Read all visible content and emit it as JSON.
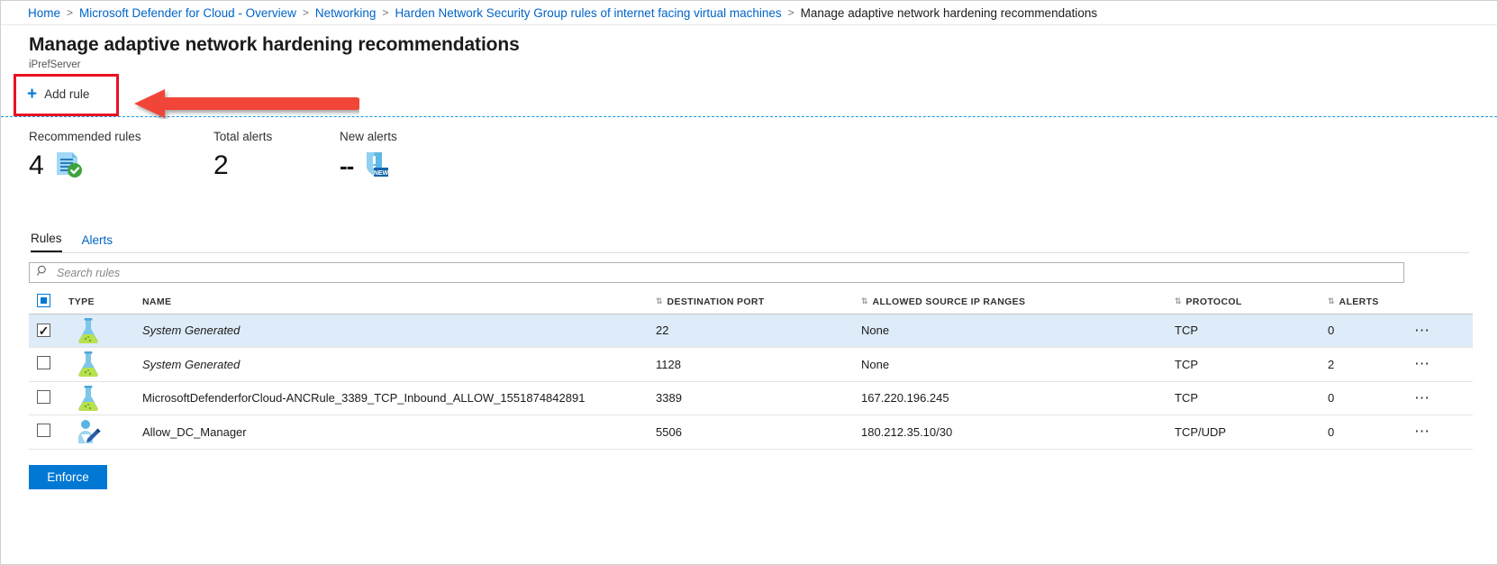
{
  "breadcrumb": {
    "items": [
      {
        "label": "Home",
        "link": true
      },
      {
        "label": "Microsoft Defender for Cloud - Overview",
        "link": true
      },
      {
        "label": "Networking",
        "link": true
      },
      {
        "label": "Harden Network Security Group rules of internet facing virtual machines",
        "link": true
      },
      {
        "label": "Manage adaptive network hardening recommendations",
        "link": false
      }
    ],
    "separator": ">"
  },
  "header": {
    "title": "Manage adaptive network hardening recommendations",
    "subtitle": "iPrefServer"
  },
  "commandbar": {
    "add_rule_label": "Add rule",
    "add_rule_icon": "plus-icon",
    "highlight_color": "#e81123",
    "annotation_arrow_color": "#f04438"
  },
  "stats": [
    {
      "label": "Recommended rules",
      "value": "4",
      "icon": "rules-document-check-icon"
    },
    {
      "label": "Total alerts",
      "value": "2",
      "icon": ""
    },
    {
      "label": "New alerts",
      "value": "--",
      "icon": "shield-new-alert-icon"
    }
  ],
  "tabs": [
    {
      "label": "Rules",
      "active": true
    },
    {
      "label": "Alerts",
      "active": false
    }
  ],
  "search": {
    "placeholder": "Search rules",
    "value": "",
    "icon": "search-icon"
  },
  "table": {
    "columns": [
      {
        "key": "check",
        "label": "",
        "sortable": false
      },
      {
        "key": "type",
        "label": "TYPE",
        "sortable": false
      },
      {
        "key": "name",
        "label": "NAME",
        "sortable": true
      },
      {
        "key": "port",
        "label": "DESTINATION PORT",
        "sortable": true
      },
      {
        "key": "ip",
        "label": "ALLOWED SOURCE IP RANGES",
        "sortable": true
      },
      {
        "key": "protocol",
        "label": "PROTOCOL",
        "sortable": true
      },
      {
        "key": "alerts",
        "label": "ALERTS",
        "sortable": false
      },
      {
        "key": "menu",
        "label": "",
        "sortable": false
      }
    ],
    "sort_icon": "sort-updown-icon",
    "menu_icon": "more-options-icon",
    "rows": [
      {
        "checked": true,
        "selected": true,
        "type_icon": "flask-system-generated-icon",
        "name": "System Generated",
        "name_italic": true,
        "port": "22",
        "ip": "None",
        "protocol": "TCP",
        "alerts": "0"
      },
      {
        "checked": false,
        "selected": false,
        "type_icon": "flask-system-generated-icon",
        "name": "System Generated",
        "name_italic": true,
        "port": "1128",
        "ip": "None",
        "protocol": "TCP",
        "alerts": "2"
      },
      {
        "checked": false,
        "selected": false,
        "type_icon": "flask-system-generated-icon",
        "name": "MicrosoftDefenderforCloud-ANCRule_3389_TCP_Inbound_ALLOW_1551874842891",
        "name_italic": false,
        "port": "3389",
        "ip": "167.220.196.245",
        "protocol": "TCP",
        "alerts": "0"
      },
      {
        "checked": false,
        "selected": false,
        "type_icon": "user-edit-custom-rule-icon",
        "name": "Allow_DC_Manager",
        "name_italic": false,
        "port": "5506",
        "ip": "180.212.35.10/30",
        "protocol": "TCP/UDP",
        "alerts": "0"
      }
    ]
  },
  "footer": {
    "enforce_label": "Enforce",
    "enforce_color": "#0078d4"
  }
}
